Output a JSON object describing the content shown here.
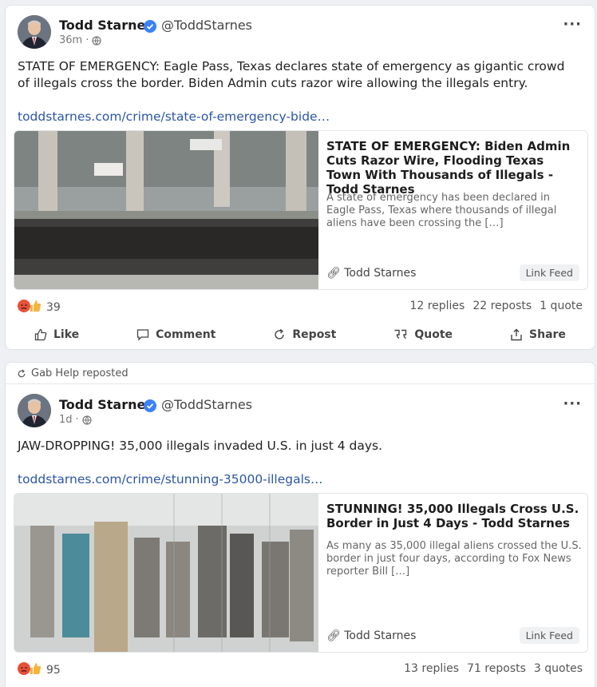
{
  "posts": [
    {
      "author": "Todd Starnes",
      "handle": "@ToddStarnes",
      "time": "36m",
      "body": "STATE OF EMERGENCY: Eagle Pass, Texas declares state of emergency as gigantic crowd of illegals cross the border. Biden Admin cuts razor wire allowing the illegals entry.",
      "link": "toddstarnes.com/crime/state-of-emergency-bide…",
      "card": {
        "title": "STATE OF EMERGENCY: Biden Admin Cuts Razor Wire, Flooding Texas Town With Thousands of Illegals - Todd Starnes",
        "description": "A state of emergency has been declared in Eagle Pass, Texas where thousands of illegal aliens have been crossing the […]",
        "source": "Todd Starnes",
        "badge": "Link Feed"
      },
      "reaction_count": "39",
      "replies": "12 replies",
      "reposts": "22 reposts",
      "quotes": "1 quote"
    },
    {
      "reposted_by": "Gab Help reposted",
      "author": "Todd Starnes",
      "handle": "@ToddStarnes",
      "time": "1d",
      "body": "JAW-DROPPING! 35,000 illegals invaded U.S. in just 4 days.",
      "link": "toddstarnes.com/crime/stunning-35000-illegals…",
      "card": {
        "title": "STUNNING! 35,000 Illegals Cross U.S. Border in Just 4 Days - Todd Starnes",
        "description": "As many as 35,000 illegal aliens crossed the U.S. border in just four days, according to Fox News reporter Bill […]",
        "source": "Todd Starnes",
        "badge": "Link Feed"
      },
      "reaction_count": "95",
      "replies": "13 replies",
      "reposts": "71 reposts",
      "quotes": "3 quotes"
    }
  ],
  "actions": {
    "like": "Like",
    "comment": "Comment",
    "repost": "Repost",
    "quote": "Quote",
    "share": "Share"
  },
  "icons": [
    "verified-icon",
    "globe-icon",
    "more-icon",
    "like-icon",
    "comment-icon",
    "repost-icon",
    "quote-icon",
    "share-icon",
    "link-icon",
    "angry-reaction-icon",
    "thumbs-up-reaction-icon"
  ],
  "colors": {
    "link": "#2b56a6",
    "verified": "#3b82f6"
  }
}
